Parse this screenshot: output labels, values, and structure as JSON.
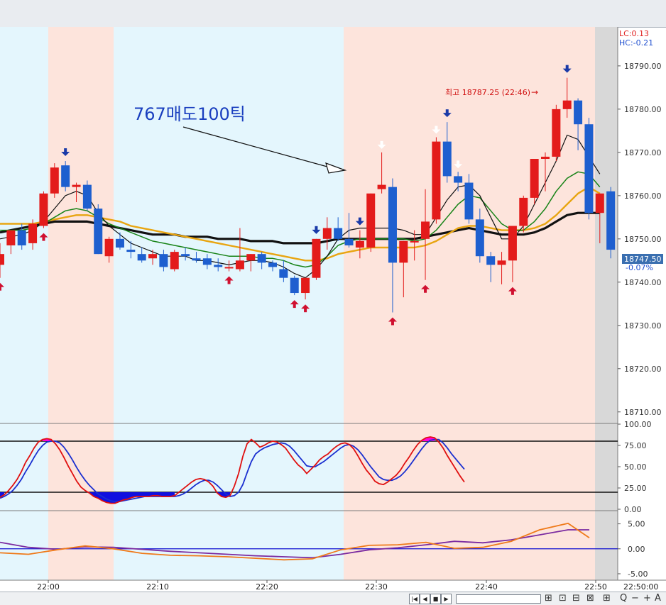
{
  "indicators": {
    "lc": "LC:0.13",
    "hc": "HC:-0.21"
  },
  "annotation": "767매도100틱",
  "high_marker": "최고 18787.25 (22:46)",
  "last_price": {
    "value": "18747.50",
    "change": "-0.07%"
  },
  "time_axis": {
    "current": "22:50:00"
  },
  "toolbar": {
    "zoom_out": "Q",
    "minus": "−",
    "plus": "+",
    "font": "A"
  },
  "colors": {
    "up": "#e31b1b",
    "down": "#1e5fcf",
    "bg_blue": "#e4f6fd",
    "bg_pink": "#fde4dc",
    "accent": "#3a6fb0"
  },
  "chart_data": [
    {
      "type": "candlestick",
      "ylim": [
        18707.5,
        18799
      ],
      "y_ticks": [
        "18710.00",
        "18720.00",
        "18730.00",
        "18740.00",
        "18750.00",
        "18760.00",
        "18770.00",
        "18780.00",
        "18790.00"
      ],
      "x_ticks": [
        "22:00",
        "22:10",
        "22:20",
        "22:30",
        "22:40",
        "22:50"
      ],
      "candles": [
        [
          18744.0,
          18749.0,
          18741.0,
          18746.5
        ],
        [
          18748.5,
          18752.0,
          18746.5,
          18752.0
        ],
        [
          18752.0,
          18753.5,
          18747.5,
          18748.5
        ],
        [
          18749.0,
          18754.5,
          18747.5,
          18753.5
        ],
        [
          18753.0,
          18761.0,
          18752.5,
          18760.5
        ],
        [
          18760.5,
          18767.5,
          18759.5,
          18766.5
        ],
        [
          18767.0,
          18768.0,
          18761.0,
          18762.0
        ],
        [
          18762.0,
          18763.0,
          18758.5,
          18762.5
        ],
        [
          18762.5,
          18763.5,
          18756.5,
          18757.0
        ],
        [
          18757.0,
          18758.0,
          18746.5,
          18746.5
        ],
        [
          18746.0,
          18750.5,
          18744.5,
          18750.0
        ],
        [
          18750.0,
          18751.5,
          18747.5,
          18748.0
        ],
        [
          18747.5,
          18749.5,
          18745.5,
          18747.0
        ],
        [
          18746.5,
          18748.0,
          18744.5,
          18745.0
        ],
        [
          18745.5,
          18747.5,
          18744.0,
          18746.5
        ],
        [
          18746.5,
          18747.5,
          18742.5,
          18743.5
        ],
        [
          18743.0,
          18747.5,
          18742.5,
          18747.0
        ],
        [
          18746.5,
          18748.0,
          18745.0,
          18746.0
        ],
        [
          18745.5,
          18747.0,
          18744.5,
          18745.0
        ],
        [
          18745.5,
          18746.5,
          18743.0,
          18744.0
        ],
        [
          18744.0,
          18745.5,
          18742.5,
          18743.5
        ],
        [
          18743.5,
          18745.0,
          18742.5,
          18743.5
        ],
        [
          18743.0,
          18752.5,
          18742.5,
          18745.0
        ],
        [
          18745.0,
          18746.5,
          18742.5,
          18746.5
        ],
        [
          18746.5,
          18747.0,
          18743.0,
          18744.5
        ],
        [
          18744.5,
          18745.0,
          18742.5,
          18743.5
        ],
        [
          18743.0,
          18745.0,
          18740.0,
          18741.0
        ],
        [
          18741.0,
          18741.5,
          18737.0,
          18737.5
        ],
        [
          18737.5,
          18741.0,
          18736.0,
          18741.0
        ],
        [
          18741.0,
          18750.0,
          18740.5,
          18750.0
        ],
        [
          18750.0,
          18755.0,
          18747.5,
          18752.5
        ],
        [
          18752.5,
          18755.0,
          18749.5,
          18750.0
        ],
        [
          18750.0,
          18756.0,
          18748.0,
          18748.5
        ],
        [
          18748.0,
          18752.0,
          18745.5,
          18749.5
        ],
        [
          18748.0,
          18760.5,
          18747.0,
          18760.5
        ],
        [
          18761.5,
          18770.0,
          18760.5,
          18762.5
        ],
        [
          18762.0,
          18764.0,
          18733.0,
          18744.5
        ],
        [
          18744.5,
          18749.5,
          18736.5,
          18749.5
        ],
        [
          18749.5,
          18752.0,
          18745.0,
          18749.5
        ],
        [
          18750.0,
          18761.5,
          18740.5,
          18754.0
        ],
        [
          18754.5,
          18773.5,
          18753.5,
          18772.5
        ],
        [
          18772.5,
          18777.0,
          18763.0,
          18764.5
        ],
        [
          18764.5,
          18765.5,
          18761.0,
          18763.0
        ],
        [
          18763.0,
          18765.0,
          18753.5,
          18754.5
        ],
        [
          18754.5,
          18757.0,
          18744.5,
          18746.0
        ],
        [
          18746.0,
          18747.0,
          18740.0,
          18744.0
        ],
        [
          18744.0,
          18747.0,
          18739.5,
          18745.0
        ],
        [
          18745.0,
          18753.0,
          18740.0,
          18753.0
        ],
        [
          18753.0,
          18760.0,
          18751.5,
          18759.5
        ],
        [
          18759.5,
          18768.5,
          18758.0,
          18768.5
        ],
        [
          18768.5,
          18770.0,
          18761.0,
          18769.0
        ],
        [
          18769.0,
          18781.0,
          18768.0,
          18780.0
        ],
        [
          18780.0,
          18787.25,
          18778.0,
          18782.0
        ],
        [
          18782.0,
          18782.5,
          18770.5,
          18776.5
        ],
        [
          18776.5,
          18778.0,
          18754.5,
          18756.0
        ],
        [
          18756.0,
          18760.5,
          18749.0,
          18760.5
        ],
        [
          18761.0,
          18762.0,
          18745.5,
          18747.5
        ]
      ],
      "ma_fast": [
        18750,
        18750.5,
        18751,
        18752,
        18754,
        18757,
        18760,
        18761,
        18760,
        18756,
        18753,
        18751,
        18749,
        18748,
        18747,
        18746,
        18746,
        18746,
        18745,
        18745,
        18744.5,
        18744,
        18744.5,
        18745,
        18745,
        18744.5,
        18743.5,
        18742,
        18741,
        18743,
        18746,
        18750,
        18752,
        18752.5,
        18752.5,
        18752.5,
        18752.5,
        18752,
        18751,
        18751,
        18755,
        18759,
        18762,
        18762.5,
        18760,
        18755,
        18750,
        18750,
        18753,
        18758,
        18763,
        18768,
        18774,
        18773,
        18769,
        18765
      ],
      "ma_green": [
        18752,
        18752,
        18752,
        18752.5,
        18753.5,
        18755,
        18756.5,
        18757,
        18756.5,
        18755,
        18753.5,
        18752.5,
        18751.5,
        18750.5,
        18749.5,
        18749,
        18748.5,
        18748,
        18747.5,
        18747,
        18746.5,
        18746,
        18746,
        18746,
        18745.5,
        18745.5,
        18745,
        18744,
        18743.5,
        18744,
        18746,
        18748.5,
        18749.5,
        18750,
        18750,
        18750,
        18750,
        18750,
        18749.5,
        18750,
        18752,
        18755,
        18758,
        18760,
        18759.5,
        18756.5,
        18753.5,
        18752,
        18752,
        18754,
        18757,
        18761,
        18764,
        18765.5,
        18765,
        18762
      ],
      "ma_orange": [
        18753.5,
        18753.5,
        18753.5,
        18753.5,
        18754,
        18754.5,
        18755,
        18755.5,
        18755.5,
        18755,
        18754.5,
        18754,
        18753,
        18752.5,
        18752,
        18751.5,
        18751,
        18750.5,
        18750,
        18749.5,
        18749,
        18748.5,
        18748,
        18747.5,
        18747,
        18746.5,
        18746,
        18745.5,
        18745,
        18745,
        18745.5,
        18746.5,
        18747,
        18747.5,
        18748,
        18748,
        18748,
        18748,
        18748,
        18748.5,
        18749.5,
        18751,
        18752.5,
        18753,
        18753,
        18752.5,
        18752,
        18752,
        18752,
        18752.5,
        18753.5,
        18755.5,
        18758,
        18760.5,
        18762,
        18760.5
      ],
      "ma_black": [
        18751.5,
        18752,
        18752.5,
        18753,
        18753.5,
        18754,
        18754,
        18754,
        18754,
        18753.5,
        18753,
        18752.5,
        18752,
        18751.5,
        18751,
        18751,
        18751,
        18750.5,
        18750.5,
        18750.5,
        18750,
        18750,
        18750,
        18749.5,
        18749.5,
        18749.5,
        18749,
        18749,
        18749,
        18749,
        18749.5,
        18750,
        18750,
        18750,
        18750,
        18750,
        18750,
        18750,
        18750,
        18750.5,
        18751,
        18751.5,
        18752,
        18752.5,
        18752,
        18751.5,
        18751,
        18751,
        18751,
        18751.5,
        18752.5,
        18754,
        18755.5,
        18756,
        18756,
        18756
      ],
      "sell_signal_candles": [
        6,
        29,
        33,
        41,
        52
      ],
      "buy_signal_candles": [
        0,
        4,
        21,
        27,
        28,
        36,
        39,
        47
      ],
      "white_signal_candles": [
        35,
        40,
        42
      ]
    },
    {
      "type": "line",
      "name": "stochastic",
      "ylim": [
        0,
        100
      ],
      "y_ticks": [
        "100.00",
        "75.00",
        "50.00",
        "25.00",
        "0.00"
      ],
      "levels": [
        80,
        20
      ],
      "x": [
        0,
        6,
        12,
        18,
        24,
        30,
        36,
        42,
        48,
        54,
        60,
        66,
        72,
        78,
        84,
        90,
        96,
        102,
        108,
        114,
        120,
        126,
        132,
        138,
        144,
        150,
        156,
        162,
        168,
        174,
        180,
        186,
        192,
        198,
        204,
        210,
        216,
        222,
        228,
        234,
        240,
        246,
        252,
        258,
        264,
        270,
        276,
        282,
        288,
        294,
        300,
        306,
        312,
        318,
        324,
        330,
        336,
        342,
        348,
        354,
        360,
        366,
        372,
        378,
        384,
        390,
        396,
        402,
        408,
        414,
        420,
        426,
        432,
        438,
        444,
        450,
        456,
        462,
        468,
        474,
        480,
        486,
        492,
        498,
        504,
        510,
        516,
        522,
        528,
        534,
        540,
        546,
        552,
        558,
        564,
        570,
        576,
        582,
        588,
        594,
        600,
        606,
        612,
        618,
        624,
        630,
        636,
        642,
        648,
        654,
        660,
        666,
        672,
        678,
        684,
        690,
        696,
        702,
        708,
        714,
        720,
        726,
        732,
        738,
        744,
        750,
        756,
        762,
        768,
        774,
        780,
        786,
        792,
        798,
        804,
        810,
        816,
        822,
        828,
        834
      ],
      "k": [
        14,
        17,
        22,
        28,
        35,
        44,
        55,
        63,
        72,
        79,
        82,
        83,
        82,
        77,
        70,
        61,
        51,
        42,
        33,
        26,
        22,
        19,
        15,
        13,
        10,
        8,
        7,
        7,
        9,
        11,
        12,
        14,
        15,
        15,
        15,
        15,
        16,
        16,
        15,
        15,
        15,
        16,
        20,
        24,
        28,
        32,
        35,
        36,
        35,
        32,
        27,
        19,
        15,
        14,
        16,
        27,
        42,
        62,
        77,
        82,
        78,
        73,
        75,
        78,
        80,
        79,
        76,
        72,
        65,
        58,
        52,
        48,
        42,
        47,
        52,
        58,
        62,
        65,
        70,
        74,
        77,
        78,
        76,
        71,
        63,
        54,
        46,
        40,
        33,
        30,
        29,
        32,
        36,
        40,
        46,
        54,
        61,
        69,
        76,
        81,
        84,
        85,
        84,
        79,
        72,
        63,
        55,
        47,
        39,
        32
      ],
      "d": [
        13,
        15,
        18,
        22,
        28,
        35,
        44,
        52,
        61,
        69,
        75,
        79,
        80,
        80,
        78,
        73,
        66,
        58,
        49,
        41,
        34,
        28,
        23,
        18,
        15,
        12,
        10,
        9,
        9,
        10,
        11,
        12,
        13,
        14,
        15,
        15,
        15,
        15,
        15,
        15,
        15,
        15,
        16,
        18,
        21,
        25,
        29,
        32,
        34,
        34,
        32,
        28,
        23,
        18,
        15,
        16,
        20,
        29,
        43,
        56,
        65,
        69,
        72,
        74,
        76,
        77,
        78,
        77,
        74,
        69,
        63,
        57,
        51,
        50,
        50,
        53,
        56,
        60,
        64,
        68,
        72,
        75,
        76,
        74,
        70,
        64,
        57,
        50,
        44,
        38,
        35,
        34,
        34,
        36,
        39,
        44,
        50,
        57,
        64,
        71,
        77,
        81,
        82,
        82,
        78,
        72,
        65,
        59,
        53,
        47
      ]
    },
    {
      "type": "line",
      "name": "macd",
      "ylim": [
        -6,
        7.5
      ],
      "y_ticks": [
        "5.00",
        "0.00",
        "-5.00"
      ],
      "x": [
        0,
        40,
        80,
        120,
        160,
        200,
        240,
        280,
        320,
        360,
        400,
        440,
        480,
        520,
        560,
        600,
        640,
        680,
        720,
        760,
        800,
        830
      ],
      "macd": [
        -0.8,
        -1.1,
        -0.2,
        0.6,
        0.0,
        -0.9,
        -1.3,
        -1.4,
        -1.6,
        -1.9,
        -2.2,
        -2.0,
        -0.2,
        0.7,
        0.8,
        1.3,
        0.1,
        0.3,
        1.5,
        3.8,
        5.1,
        2.2
      ],
      "signal": [
        1.3,
        0.3,
        -0.1,
        0.4,
        0.3,
        -0.1,
        -0.5,
        -0.8,
        -1.1,
        -1.4,
        -1.6,
        -1.8,
        -1.1,
        -0.2,
        0.2,
        0.8,
        1.5,
        1.2,
        1.8,
        2.8,
        3.8,
        3.8
      ]
    }
  ]
}
